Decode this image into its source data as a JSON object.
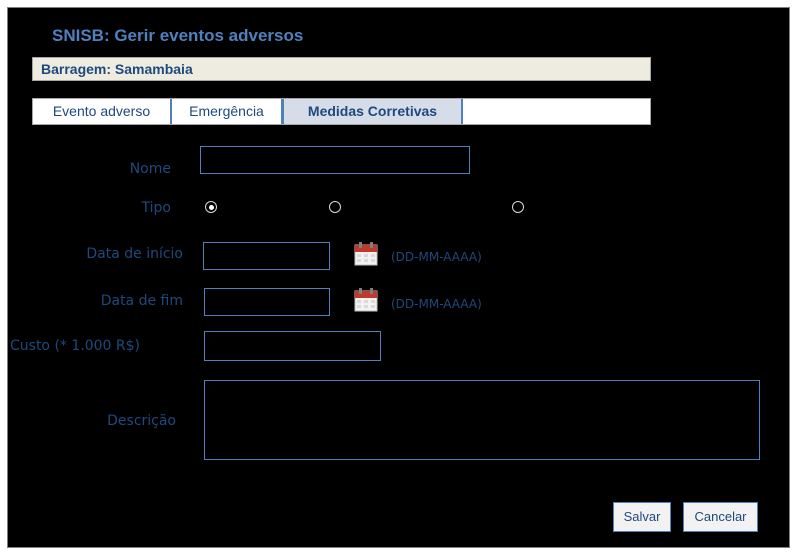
{
  "header": {
    "title": "SNISB: Gerir eventos adversos"
  },
  "dam": {
    "label": "Barragem: Samambaia"
  },
  "tabs": [
    {
      "label": "Evento adverso",
      "active": false
    },
    {
      "label": "Emergência",
      "active": false
    },
    {
      "label": "Medidas Corretivas",
      "active": true
    }
  ],
  "form": {
    "name": {
      "label": "Nome",
      "value": ""
    },
    "type": {
      "label": "Tipo",
      "options": [
        {
          "selected": true
        },
        {
          "selected": false
        },
        {
          "selected": false
        }
      ]
    },
    "start_date": {
      "label": "Data de início",
      "value": "",
      "format_hint": "(DD-MM-AAAA)"
    },
    "end_date": {
      "label": "Data de fim",
      "value": "",
      "format_hint": "(DD-MM-AAAA)"
    },
    "cost": {
      "label": "Custo (* 1.000 R$)",
      "value": ""
    },
    "description": {
      "label": "Descrição",
      "value": ""
    }
  },
  "actions": {
    "save": "Salvar",
    "cancel": "Cancelar"
  },
  "colors": {
    "background": "#000000",
    "accent": "#4f81bd",
    "label": "#1f497d",
    "bar": "#eeece1"
  },
  "icons": {
    "calendar": "calendar-icon"
  }
}
